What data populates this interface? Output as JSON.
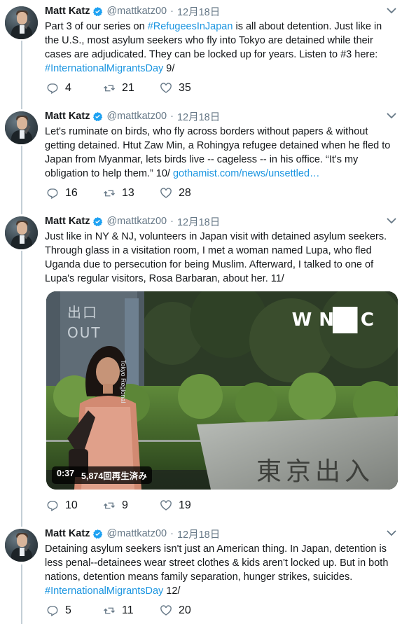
{
  "author": {
    "name": "Matt Katz",
    "handle": "@mattkatz00",
    "dot": "·",
    "date": "12月18日"
  },
  "colors": {
    "link": "#1b95e0",
    "text": "#14171a",
    "muted": "#657786",
    "verified": "#1da1f2"
  },
  "tweets": [
    {
      "text_pre": "Part 3 of our series on ",
      "link1": "#RefugeesInJapan",
      "text_mid": " is all about detention. Just like in the U.S., most asylum seekers who fly into Tokyo are detained while their cases are adjudicated. They can be locked up for years. Listen to #3 here: ",
      "link2": "#InternationalMigrantsDay",
      "text_post": " 9/",
      "replies": "4",
      "retweets": "21",
      "likes": "35"
    },
    {
      "text_pre": "Let's ruminate on birds, who fly across borders without papers & without getting detained. Htut Zaw Min, a Rohingya refugee detained when he fled to Japan from Myanmar, lets birds live -- cageless -- in his office. “It's my obligation to help them.” 10/  ",
      "link1": "gothamist.com/news/unsettled…",
      "replies": "16",
      "retweets": "13",
      "likes": "28"
    },
    {
      "text_pre": "Just like in NY & NJ, volunteers in Japan visit with detained asylum seekers. Through glass in a visitation room, I met a woman named Lupa, who fled Uganda due to persecution for being Muslim. Afterward, I talked to one of Lupa's regular visitors, Rosa Barbaran, about her. 11/",
      "replies": "10",
      "retweets": "9",
      "likes": "19",
      "video": {
        "duration": "0:37",
        "views": "5,874回再生済み",
        "logo": "WNYC",
        "sign_top": "出口",
        "sign_out": "OUT",
        "sign_bottom": "東京出入",
        "sign_side": "Tokyo Regional"
      }
    },
    {
      "text_pre": "Detaining asylum seekers isn't just an American thing. In Japan, detention is less penal--detainees wear street clothes & kids aren't locked up. But in both nations, detention means family separation, hunger strikes, suicides. ",
      "link1": "#InternationalMigrantsDay",
      "text_post": " 12/",
      "replies": "5",
      "retweets": "11",
      "likes": "20"
    }
  ]
}
